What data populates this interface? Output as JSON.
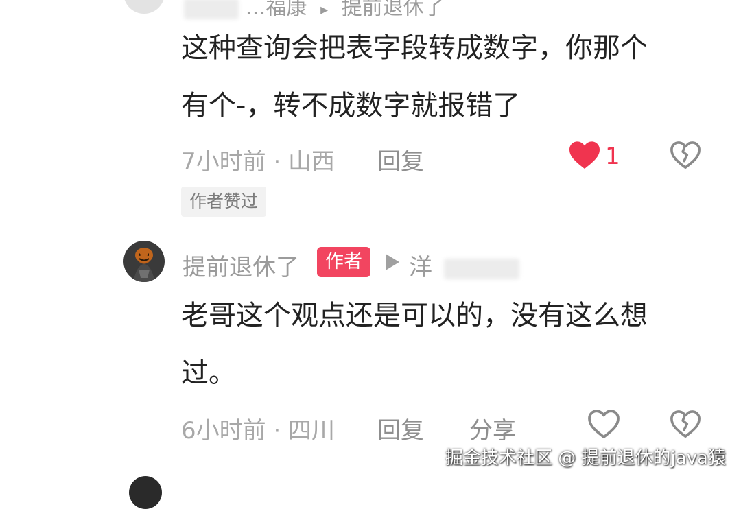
{
  "top_comment": {
    "username_partial": "…福康",
    "reply_target": "提前退休了",
    "text_line1": "这种查询会把表字段转成数字，你那个",
    "text_line2": "有个-，转不成数字就报错了",
    "time_location": "7小时前 · 山西",
    "reply_label": "回复",
    "like_count": "1",
    "author_liked_badge": "作者赞过"
  },
  "author_reply": {
    "username": "提前退休了",
    "author_tag": "作者",
    "reply_to_partial": "洋",
    "text_line1": "老哥这个观点还是可以的，没有这么想",
    "text_line2": "过。",
    "time_location": "6小时前 · 四川",
    "reply_label": "回复",
    "share_label": "分享"
  },
  "watermark": "掘金技术社区 @ 提前退休的java猿",
  "colors": {
    "like_red": "#f0344f",
    "author_tag_bg": "#f24560",
    "meta_gray": "#a8a8a8"
  },
  "icons": {
    "liked": "heart-filled-icon",
    "like": "heart-outline-icon",
    "dislike": "broken-heart-icon",
    "reply_arrow": "play-triangle-icon"
  }
}
